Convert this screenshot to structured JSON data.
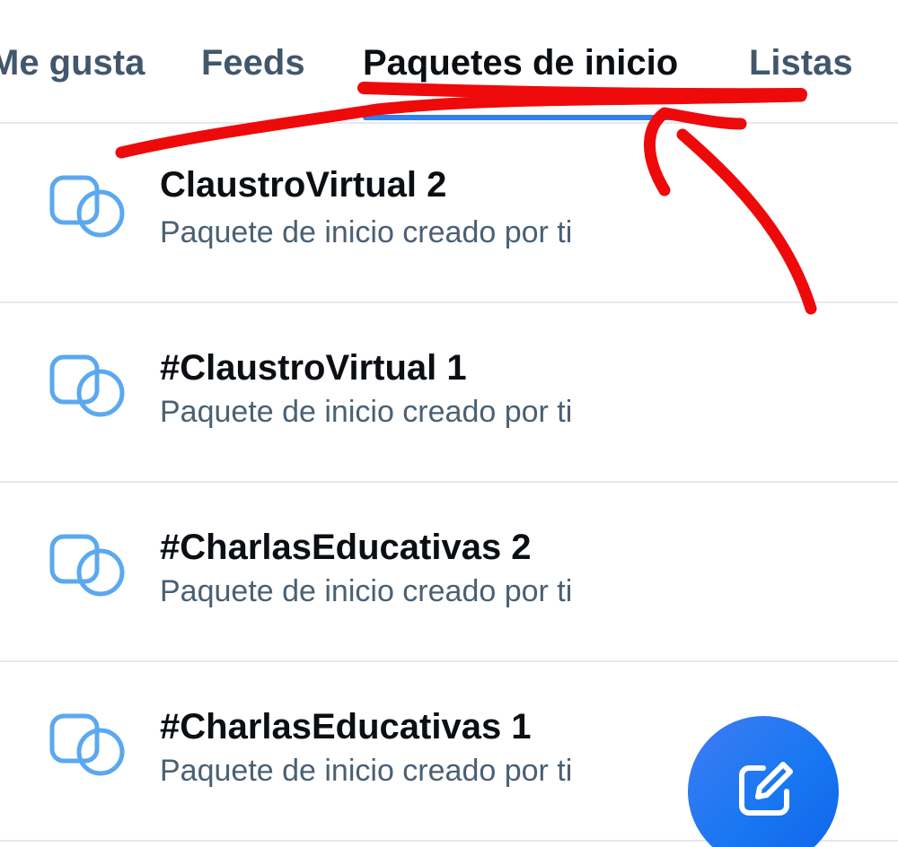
{
  "tabs": [
    {
      "label": "Me gusta",
      "active": false
    },
    {
      "label": "Feeds",
      "active": false
    },
    {
      "label": "Paquetes de inicio",
      "active": true
    },
    {
      "label": "Listas",
      "active": false
    }
  ],
  "starter_packs": [
    {
      "title": "ClaustroVirtual 2",
      "subtitle": "Paquete de inicio creado por ti",
      "icon": "starter-pack-icon"
    },
    {
      "title": "#ClaustroVirtual 1",
      "subtitle": "Paquete de inicio creado por ti",
      "icon": "starter-pack-icon"
    },
    {
      "title": "#CharlasEducativas 2",
      "subtitle": "Paquete de inicio creado por ti",
      "icon": "starter-pack-icon"
    },
    {
      "title": "#CharlasEducativas 1",
      "subtitle": "Paquete de inicio creado por ti",
      "icon": "starter-pack-icon"
    }
  ],
  "fab": {
    "icon": "compose-icon"
  },
  "colors": {
    "accent": "#2f80f0",
    "icon": "#5aa9f0",
    "annotation": "#ee0a0a",
    "fab": "#1877f2"
  }
}
